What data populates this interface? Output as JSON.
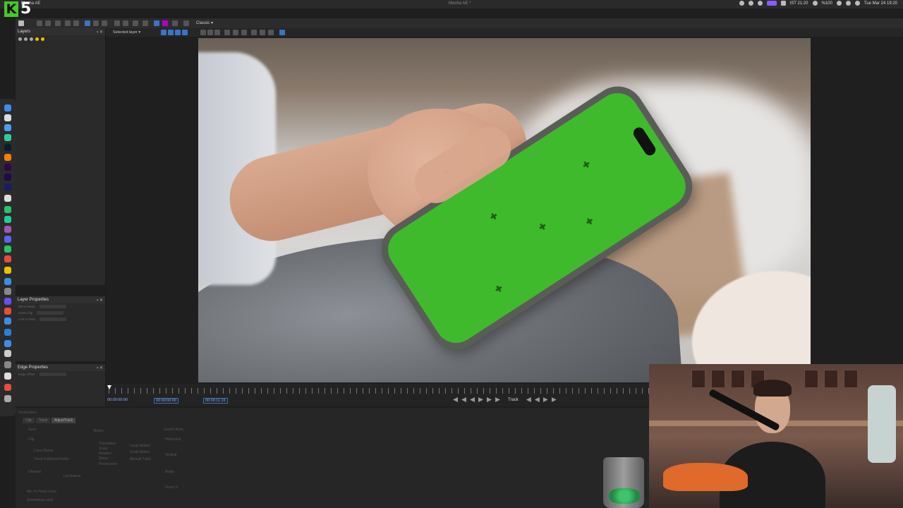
{
  "menubar": {
    "app_title": "Mocha AE",
    "window_title": "Mocha AE *",
    "battery": "%100",
    "clock": "IST 21:20",
    "date": "Tue Mar 24  19:20"
  },
  "logo": {
    "letter": "K",
    "number": "5"
  },
  "toolbar": {
    "view_mode": "Classic ▾"
  },
  "toolbar2": {
    "layer_select": "Selected layer ▾"
  },
  "layers_panel": {
    "title": "Layers"
  },
  "layer_properties": {
    "title": "Layer Properties",
    "rows": [
      "Blend Mode",
      "Insert Clip",
      "Link to track"
    ]
  },
  "edge_properties": {
    "title": "Edge Properties",
    "rows": [
      "Edge Offset"
    ]
  },
  "timeline": {
    "tc_in": "00:00:00:00",
    "tc_current": "00:00:00:00",
    "tc_out": "00:00:11:16",
    "track_label": "Track"
  },
  "params": {
    "title": "Parameters",
    "tabs": [
      "Clip",
      "Track",
      "AdjustTrack"
    ],
    "labels": [
      "Input",
      "Motion",
      "Search Area",
      "Clip",
      "Layer Below",
      "Track Individual Fields",
      "Translation",
      "Scale",
      "Rotation",
      "Shear",
      "Perspective",
      "Large Motion",
      "Small Motion",
      "Manual Track",
      "Horizontal",
      "Vertical",
      "Angle",
      "Zoom %",
      "Channel",
      "Luminance",
      "Min % Pixels Used",
      "Smoothing Level"
    ]
  },
  "colors": {
    "accent": "#3b73c6",
    "screen_green": "#3fba2c",
    "logo_green": "#49c62b"
  },
  "icons": [
    "download-icon",
    "select-icon",
    "hand-icon",
    "zoom-icon",
    "pen-icon",
    "add-icon",
    "play-icon",
    "step-forward-icon",
    "step-back-icon"
  ]
}
